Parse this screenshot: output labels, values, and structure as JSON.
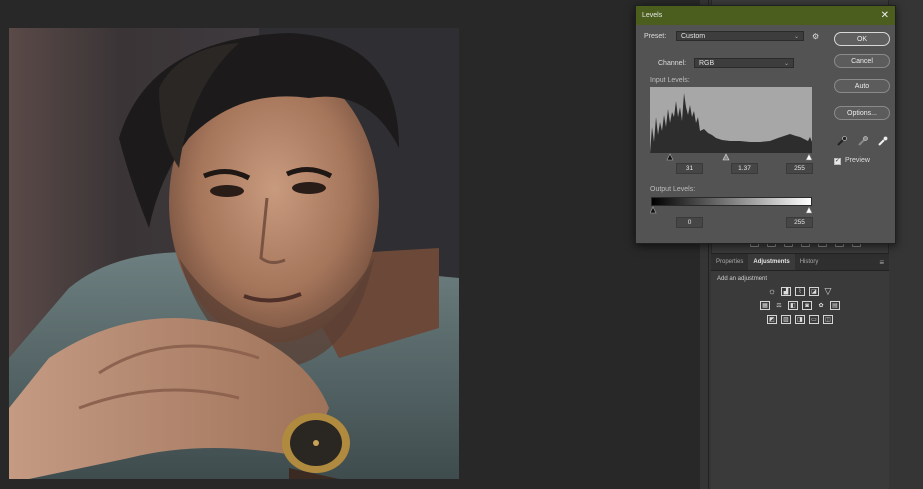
{
  "dialog": {
    "title": "Levels",
    "close_glyph": "✕",
    "preset_label": "Preset:",
    "preset_value": "Custom",
    "channel_label": "Channel:",
    "channel_value": "RGB",
    "input_levels_label": "Input Levels:",
    "output_levels_label": "Output Levels:",
    "input_black": "31",
    "input_gamma": "1.37",
    "input_white": "255",
    "output_black": "0",
    "output_white": "255",
    "buttons": {
      "ok": "OK",
      "cancel": "Cancel",
      "auto": "Auto",
      "options": "Options..."
    },
    "preview_label": "Preview",
    "preview_checked": true,
    "titlebar_color": "#4b5e1e"
  },
  "adjustments_panel": {
    "tabs": [
      "Properties",
      "Adjustments",
      "History"
    ],
    "active_tab": "Adjustments",
    "add_label": "Add an adjustment",
    "row1_icons": [
      "brightness-contrast-icon",
      "levels-icon",
      "curves-icon",
      "exposure-icon",
      "vibrance-icon"
    ],
    "row2_icons": [
      "hue-saturation-icon",
      "color-balance-icon",
      "black-white-icon",
      "photo-filter-icon",
      "channel-mixer-icon",
      "color-lookup-icon"
    ],
    "row3_icons": [
      "invert-icon",
      "posterize-icon",
      "threshold-icon",
      "gradient-map-icon",
      "selective-color-icon"
    ]
  },
  "histogram": {
    "channel": "RGB",
    "input_black": 31,
    "input_gamma": 1.37,
    "input_white": 255
  }
}
